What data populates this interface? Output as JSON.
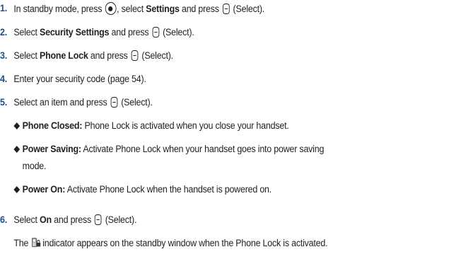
{
  "steps": [
    {
      "num": "1.",
      "pre": "In standby mode, press",
      "mid": ", select",
      "bold": "Settings",
      "post": "and press",
      "tail": "(Select)."
    },
    {
      "num": "2.",
      "pre": "Select",
      "bold": "Security Settings",
      "post": "and press",
      "tail": "(Select)."
    },
    {
      "num": "3.",
      "pre": "Select",
      "bold": "Phone Lock",
      "post": "and press",
      "tail": "(Select)."
    },
    {
      "num": "4.",
      "text": "Enter your security code (page 54)."
    },
    {
      "num": "5.",
      "pre": "Select an item and press",
      "tail": "(Select)."
    },
    {
      "num": "6.",
      "pre": "Select",
      "bold": "On",
      "post": "and press",
      "tail": "(Select)."
    }
  ],
  "options": [
    {
      "term": "Phone Closed:",
      "desc": "Phone Lock is activated when you close your handset."
    },
    {
      "term": "Power Saving:",
      "desc": "Activate Phone Lock when your handset goes into power saving",
      "desc_cont": "mode."
    },
    {
      "term": "Power On:",
      "desc": "Activate Phone Lock when the handset is powered on."
    }
  ],
  "note": {
    "pre": "The",
    "post": "indicator appears on the standby window when the Phone Lock is activated."
  },
  "icons": {
    "center_key": "center-select-key-icon",
    "soft_key": "left-softkey-icon",
    "lock_indicator": "phone-lock-indicator-icon",
    "bullet": "diamond-bullet-icon"
  },
  "colors": {
    "number": "#1b4e8c",
    "text": "#231f20"
  }
}
